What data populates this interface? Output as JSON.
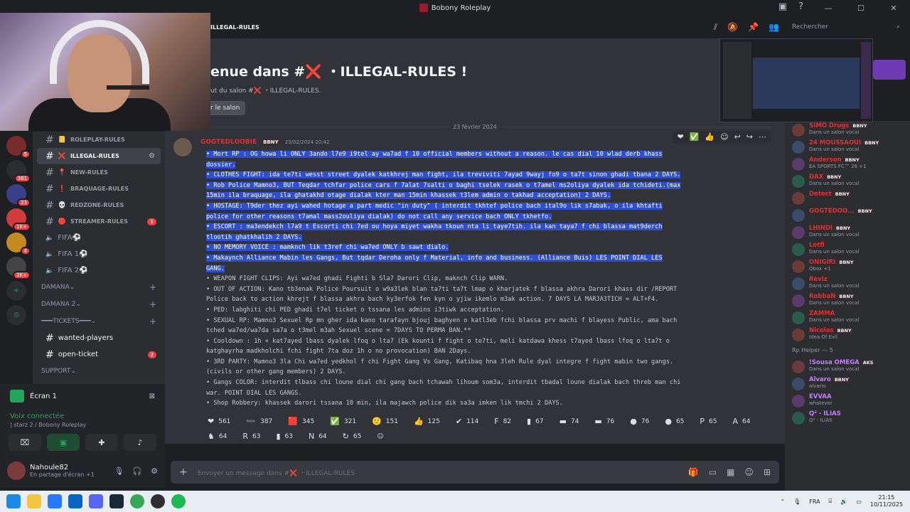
{
  "window": {
    "title": "Bobony Roleplay",
    "search_placeholder": "Rechercher"
  },
  "channel": {
    "header_name": "ILLEGAL-RULES",
    "welcome": "enue dans #❌ ・ILLEGAL-RULES !",
    "welcome_sub": "ut du salon #❌ ・ILLEGAL-RULES.",
    "edit_label": "r le salon",
    "date_separator": "23 février 2024"
  },
  "server_badges": [
    "5",
    "381",
    "23",
    "1K+",
    "4",
    "2K+"
  ],
  "channels": [
    {
      "emoji": "📒",
      "label": "ROLEPLAY-RULES",
      "badge": "",
      "active": false
    },
    {
      "emoji": "❌",
      "label": "ILLEGAL-RULES",
      "badge": "",
      "active": true
    },
    {
      "emoji": "📍",
      "label": "NEW-RULES",
      "badge": "",
      "active": false
    },
    {
      "emoji": "❗",
      "label": "BRAQUAGE-RULES",
      "badge": "",
      "active": false
    },
    {
      "emoji": "💀",
      "label": "REDZONE-RULES",
      "badge": "",
      "active": false
    },
    {
      "emoji": "🔴",
      "label": "STREAMER-RULES",
      "badge": "1",
      "active": false
    }
  ],
  "voice_channels": [
    {
      "label": "FIFA"
    },
    {
      "label": "FIFA 1"
    },
    {
      "label": "FIFA 2"
    }
  ],
  "categories": {
    "damana": "DAMANA",
    "damana2": "DAMANA 2",
    "tickets": "━━━TICKETS━━━",
    "support": "SUPPORT"
  },
  "text_channels2": [
    {
      "label": "wanted-players",
      "badge": ""
    },
    {
      "label": "open-ticket",
      "badge": "2"
    }
  ],
  "panel": {
    "screen_label": "Écran 1",
    "voice_connected": "Voix connectée",
    "voice_sub": "| starz 2 / Bobony Roleplay",
    "username": "Nahoule82",
    "user_status": "En partage d'écran +1"
  },
  "message": {
    "author": "GOGTEDLOOBIE",
    "tag": "BBNY",
    "timestamp": "23/02/2024 20:42",
    "lines": [
      {
        "t": "• Mort RP : OG howa li ONLY 3ando l7e9 i9tel ay wa7ad f 10 official members without a reason. le cas dial 10 wlad derb khass",
        "hl": true
      },
      {
        "t": "dossier.",
        "hl": true
      },
      {
        "t": "• CLOTHES FIGHT: ida te7ti wesst street dyalek katkhrej man fight, ila treviviti 7ayad 9wayj fo9 o ta7t sinon ghadi tbana 2 DAYS.",
        "hl": true
      },
      {
        "t": "• Rob Police Mamno3, BUT Teqdar tchfar police cars f 7alat 7salti o baghi tselek rasek o t7amel ms2oliya dyalek ida tchideti.(max",
        "hl": true
      },
      {
        "t": "15min ila braquage, ila ghatakhd otage dialak kter man 15min khassek t3lem admin o takhad acceptation) 2 DAYS.",
        "hl": true
      },
      {
        "t": "• HOSTAGE: T9der thez ayi wahed hotage a part medic \"in duty\" ( interdit tkhtef police bach ital9o lik s7abak, o ila khtafti",
        "hl": true
      },
      {
        "t": "police for other reasons t7amal mass2ouliya dialak) do not call any service bach ONLY tkhetfo.",
        "hl": true
      },
      {
        "t": "• ESCORT : ma3endekch l7a9 t Escorti chi 7ed ou hoya miyet wakha tkoun nta li taye7tih. ila kan taya7 f chi blassa mat9derch",
        "hl": true
      },
      {
        "t": "tlootih ghatkhalih 2 DAYS.",
        "hl": true
      },
      {
        "t": "• NO MEMORY VOICE : mamknch lik t3ref chi wa7ed ONLY b sawt dialo.",
        "hl": true
      },
      {
        "t": "• Makaynch Alliance Mabin les Gangs, But tqdar Deroha only f Material, info and business. (Alliance Buis) LES POINT DIAL LES",
        "hl": true
      },
      {
        "t": "GANG.",
        "hl": true
      },
      {
        "t": "• WEAPON FIGHT CLIPS: Ayi wa7ed ghadi Fighti b Sla7 Darori Clip, maknch Clip WARN.",
        "hl": false
      },
      {
        "t": "• OUT OF ACTION: Kano tb3enak Police Poursuit o w9a3lek blan ta7ti ta7t lmap o kharjatek f blassa akhra Darori khass dir /REPORT",
        "hl": false
      },
      {
        "t": "Police back to action khrejt f blassa akhra bach ky3erfok fen kyn o yjiw ikemlo m3ak action. 7 DAYS LA MARJA3TICH = ALT+F4.",
        "hl": false
      },
      {
        "t": "• PED: labghiti chi PED ghadi t7el ticket o tssana les admins i3tiwk acceptation.",
        "hl": false
      },
      {
        "t": "• SEXUAL RP: Mamno3 Sexuel Rp mn gher ida kano tarafayn bjouj baghyen o katl3eb fchi blassa prv machi f blayess Public, ama bach",
        "hl": false
      },
      {
        "t": "tched wa7ed/wa7da sa7a o t3mel m3ah Sexuel scene = 7DAYS TO PERMA BAN.**",
        "hl": false
      },
      {
        "t": "• Cooldown : 1h + kat7ayed lbass dyalek lfoq o lta7 (Ek kounti f fight o te7ti, meli katdawa khess t7ayed lbass lfoq o lta7t o",
        "hl": false
      },
      {
        "t": "katghayrha madkholchi fchi fight 7ta doz 1h o no provocation) BAN 2Days.",
        "hl": false
      },
      {
        "t": "• 3RD PARTY: Mamno3 3la Chi wa7ed yedkhol f chi Fight Gang Vs Gang, Katibaq hna 3leh Rule dyal integre f fight mabin two gangs.",
        "hl": false
      },
      {
        "t": "(civils or other gang members) 2 DAYS.",
        "hl": false
      },
      {
        "t": "• Gangs COLOR: interdit tlbass chi loune dial chi gang bach tchawah lihoum som3a, interdit tbadal loune dialak bach threb man chi",
        "hl": false
      },
      {
        "t": "war. POINT DIAL LES GANGS.",
        "hl": false
      },
      {
        "t": "• Shop Robbery: khassek darori tssana 10 min, ila majawch police dik sa3a imken lik tmchi 2 DAYS.",
        "hl": false
      }
    ]
  },
  "reactions": [
    {
      "icon": "❤",
      "count": "561"
    },
    {
      "icon": "➖",
      "count": "387"
    },
    {
      "icon": "🟥",
      "count": "345"
    },
    {
      "icon": "✅",
      "count": "321"
    },
    {
      "icon": "🙂",
      "count": "151"
    },
    {
      "icon": "👍",
      "count": "125"
    },
    {
      "icon": "✔",
      "count": "114"
    },
    {
      "icon": "F",
      "count": "82"
    },
    {
      "icon": "▮",
      "count": "67"
    },
    {
      "icon": "▬",
      "count": "74"
    },
    {
      "icon": "▬",
      "count": "76"
    },
    {
      "icon": "●",
      "count": "76"
    },
    {
      "icon": "●",
      "count": "65"
    },
    {
      "icon": "P",
      "count": "65"
    },
    {
      "icon": "A",
      "count": "64"
    },
    {
      "icon": "♞",
      "count": "64"
    },
    {
      "icon": "R",
      "count": "63"
    },
    {
      "icon": "▮",
      "count": "63"
    },
    {
      "icon": "N",
      "count": "64"
    },
    {
      "icon": "↻",
      "count": "65"
    }
  ],
  "composer": {
    "placeholder": "Envoyer un message dans #❌ ・ILLEGAL-RULES"
  },
  "members": [
    {
      "name": "SIMO Drugs",
      "status": "Dans un salon vocal",
      "badge": "BBNY",
      "color": "#e03131"
    },
    {
      "name": "24 MOUSSAOUI",
      "status": "Dans un salon vocal",
      "badge": "BBNY",
      "color": "#e03131"
    },
    {
      "name": "Anderson",
      "status": "EA SPORTS FC™ 26 +1",
      "badge": "BBNY",
      "color": "#e03131"
    },
    {
      "name": "DAX",
      "status": "Dans un salon vocal",
      "badge": "BBNY",
      "color": "#e03131"
    },
    {
      "name": "Detect",
      "status": "",
      "badge": "BBNY",
      "color": "#e03131"
    },
    {
      "name": "GOGTEDOO...",
      "status": "",
      "badge": "BBNY",
      "color": "#e03131"
    },
    {
      "name": "LHINDI",
      "status": "Dans un salon vocal",
      "badge": "BBNY",
      "color": "#e03131"
    },
    {
      "name": "Lotfi",
      "status": "Dans un salon vocal",
      "badge": "",
      "color": "#e03131"
    },
    {
      "name": "ONIGIRI",
      "status": "Qbox +1",
      "badge": "BBNY",
      "color": "#e03131"
    },
    {
      "name": "Reviz",
      "status": "Dans un salon vocal",
      "badge": "",
      "color": "#e03131"
    },
    {
      "name": "RobbaN",
      "status": "Dans un salon vocal",
      "badge": "BBNY",
      "color": "#e03131"
    },
    {
      "name": "ZAMMA",
      "status": "Dans un salon vocal",
      "badge": "",
      "color": "#e03131"
    },
    {
      "name": "Nicolas",
      "status": "Idea Of Evil",
      "badge": "BBNY",
      "color": "#e03131"
    }
  ],
  "role2": {
    "header": "Rp Helper — 5"
  },
  "members2": [
    {
      "name": "!Sousa OMEGA",
      "status": "Dans un salon vocal",
      "badge": "AKS",
      "color": "#c77dff"
    },
    {
      "name": "Alvaro",
      "status": "alvario",
      "badge": "BBNY",
      "color": "#c77dff"
    },
    {
      "name": "EVVAA",
      "status": "whatever",
      "badge": "",
      "color": "#c77dff"
    },
    {
      "name": "Q² - ILIAS",
      "status": "Q² - ILIAS",
      "badge": "",
      "color": "#c77dff"
    }
  ],
  "taskbar": {
    "lang": "FRA",
    "time": "21:15",
    "date": "10/11/2025"
  }
}
